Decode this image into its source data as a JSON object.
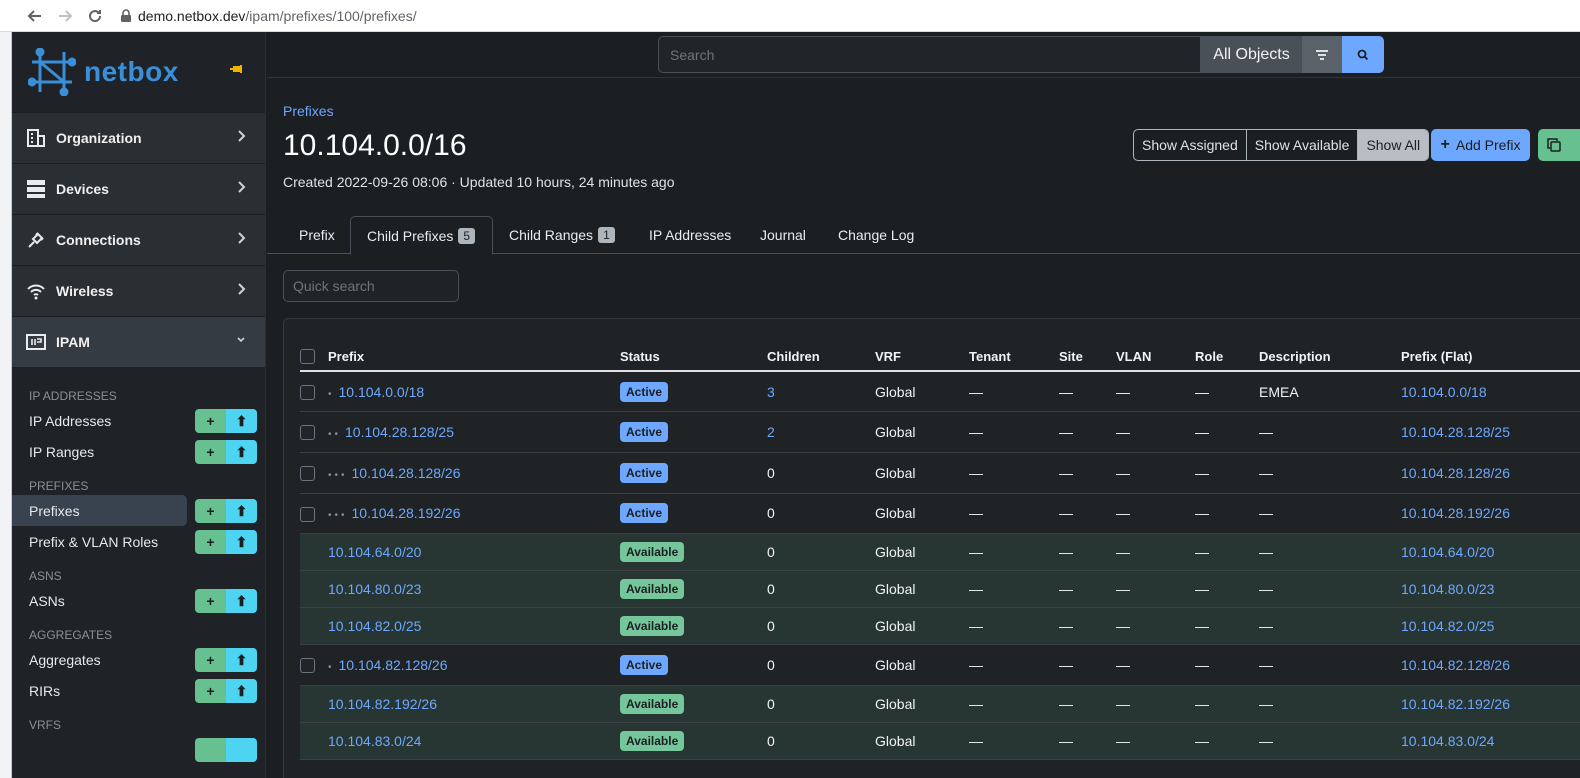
{
  "browser": {
    "url_host": "demo.netbox.dev",
    "url_path": "/ipam/prefixes/100/prefixes/"
  },
  "brand": {
    "name": "netbox"
  },
  "sidebar": {
    "sections": [
      {
        "label": "Organization",
        "icon": "building-icon"
      },
      {
        "label": "Devices",
        "icon": "server-icon"
      },
      {
        "label": "Connections",
        "icon": "plug-icon"
      },
      {
        "label": "Wireless",
        "icon": "wifi-icon"
      },
      {
        "label": "IPAM",
        "icon": "ipam-icon"
      }
    ],
    "groups": [
      {
        "title": "IP ADDRESSES",
        "items": [
          {
            "label": "IP Addresses"
          },
          {
            "label": "IP Ranges"
          }
        ]
      },
      {
        "title": "PREFIXES",
        "items": [
          {
            "label": "Prefixes"
          },
          {
            "label": "Prefix & VLAN Roles"
          }
        ]
      },
      {
        "title": "ASNS",
        "items": [
          {
            "label": "ASNs"
          }
        ]
      },
      {
        "title": "AGGREGATES",
        "items": [
          {
            "label": "Aggregates"
          },
          {
            "label": "RIRs"
          }
        ]
      },
      {
        "title": "VRFS",
        "items": []
      }
    ],
    "add_glyph": "+",
    "import_glyph": "⬆"
  },
  "search": {
    "placeholder": "Search",
    "scope": "All Objects"
  },
  "header": {
    "breadcrumb": "Prefixes",
    "title": "10.104.0.0/16",
    "meta": "Created 2022-09-26 08:06 · Updated 10 hours, 24 minutes ago"
  },
  "toggle": {
    "assigned": "Show Assigned",
    "available": "Show Available",
    "all": "Show All"
  },
  "actions": {
    "add_label": "Add Prefix",
    "add_glyph": "+"
  },
  "tabs": {
    "prefix": "Prefix",
    "child_prefixes": "Child Prefixes",
    "child_prefixes_count": "5",
    "child_ranges": "Child Ranges",
    "child_ranges_count": "1",
    "ip_addresses": "IP Addresses",
    "journal": "Journal",
    "change_log": "Change Log"
  },
  "quick_search": {
    "placeholder": "Quick search"
  },
  "table": {
    "columns": [
      "Prefix",
      "Status",
      "Children",
      "VRF",
      "Tenant",
      "Site",
      "VLAN",
      "Role",
      "Description",
      "Prefix (Flat)"
    ],
    "rows": [
      {
        "type": "active",
        "depth": 1,
        "prefix": "10.104.0.0/18",
        "status": "Active",
        "children": "3",
        "children_link": true,
        "vrf": "Global",
        "tenant": "—",
        "site": "—",
        "vlan": "—",
        "role": "—",
        "description": "EMEA",
        "flat": "10.104.0.0/18"
      },
      {
        "type": "active",
        "depth": 2,
        "prefix": "10.104.28.128/25",
        "status": "Active",
        "children": "2",
        "children_link": true,
        "vrf": "Global",
        "tenant": "—",
        "site": "—",
        "vlan": "—",
        "role": "—",
        "description": "—",
        "flat": "10.104.28.128/25"
      },
      {
        "type": "active",
        "depth": 3,
        "prefix": "10.104.28.128/26",
        "status": "Active",
        "children": "0",
        "children_link": false,
        "vrf": "Global",
        "tenant": "—",
        "site": "—",
        "vlan": "—",
        "role": "—",
        "description": "—",
        "flat": "10.104.28.128/26"
      },
      {
        "type": "active",
        "depth": 3,
        "prefix": "10.104.28.192/26",
        "status": "Active",
        "children": "0",
        "children_link": false,
        "vrf": "Global",
        "tenant": "—",
        "site": "—",
        "vlan": "—",
        "role": "—",
        "description": "—",
        "flat": "10.104.28.192/26"
      },
      {
        "type": "available",
        "depth": 0,
        "prefix": "10.104.64.0/20",
        "status": "Available",
        "children": "0",
        "children_link": false,
        "vrf": "Global",
        "tenant": "—",
        "site": "—",
        "vlan": "—",
        "role": "—",
        "description": "—",
        "flat": "10.104.64.0/20"
      },
      {
        "type": "available",
        "depth": 0,
        "prefix": "10.104.80.0/23",
        "status": "Available",
        "children": "0",
        "children_link": false,
        "vrf": "Global",
        "tenant": "—",
        "site": "—",
        "vlan": "—",
        "role": "—",
        "description": "—",
        "flat": "10.104.80.0/23"
      },
      {
        "type": "available",
        "depth": 0,
        "prefix": "10.104.82.0/25",
        "status": "Available",
        "children": "0",
        "children_link": false,
        "vrf": "Global",
        "tenant": "—",
        "site": "—",
        "vlan": "—",
        "role": "—",
        "description": "—",
        "flat": "10.104.82.0/25"
      },
      {
        "type": "active",
        "depth": 1,
        "prefix": "10.104.82.128/26",
        "status": "Active",
        "children": "0",
        "children_link": false,
        "vrf": "Global",
        "tenant": "—",
        "site": "—",
        "vlan": "—",
        "role": "—",
        "description": "—",
        "flat": "10.104.82.128/26"
      },
      {
        "type": "available",
        "depth": 0,
        "prefix": "10.104.82.192/26",
        "status": "Available",
        "children": "0",
        "children_link": false,
        "vrf": "Global",
        "tenant": "—",
        "site": "—",
        "vlan": "—",
        "role": "—",
        "description": "—",
        "flat": "10.104.82.192/26"
      },
      {
        "type": "available",
        "depth": 0,
        "prefix": "10.104.83.0/24",
        "status": "Available",
        "children": "0",
        "children_link": false,
        "vrf": "Global",
        "tenant": "—",
        "site": "—",
        "vlan": "—",
        "role": "—",
        "description": "—",
        "flat": "10.104.83.0/24"
      }
    ]
  },
  "colors": {
    "accent": "#6ea8fe",
    "success": "#75c69b",
    "brand": "#3b8fd9"
  }
}
